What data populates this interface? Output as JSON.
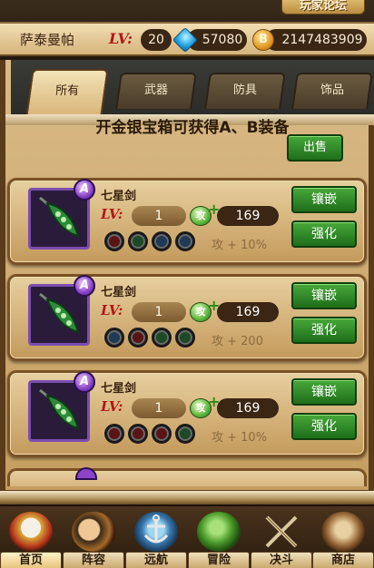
{
  "header": {
    "forum_tag": "玩家论坛",
    "player_name": "萨泰曼帕",
    "lv_label": "LV:",
    "level": "20",
    "gems": "57080",
    "coin_symbol": "B",
    "coins": "2147483909"
  },
  "tabs": [
    {
      "label": "所有",
      "active": true
    },
    {
      "label": "武器",
      "active": false
    },
    {
      "label": "防具",
      "active": false
    },
    {
      "label": "饰品",
      "active": false
    }
  ],
  "info_text": "开金银宝箱可获得A、B装备",
  "sell_label": "出售",
  "items": [
    {
      "grade": "A",
      "name": "七星剑",
      "lv_label": "LV:",
      "level": "1",
      "atk_icon_label": "攻",
      "plus": "+",
      "attack": "169",
      "bonus": "攻 + 10%",
      "sockets": [
        "red",
        "green",
        "blue",
        "blue"
      ],
      "inlay_label": "镶嵌",
      "enhance_label": "强化"
    },
    {
      "grade": "A",
      "name": "七星剑",
      "lv_label": "LV:",
      "level": "1",
      "atk_icon_label": "攻",
      "plus": "+",
      "attack": "169",
      "bonus": "攻 + 200",
      "sockets": [
        "blue",
        "red",
        "green",
        "green"
      ],
      "inlay_label": "镶嵌",
      "enhance_label": "强化"
    },
    {
      "grade": "A",
      "name": "七星剑",
      "lv_label": "LV:",
      "level": "1",
      "atk_icon_label": "攻",
      "plus": "+",
      "attack": "169",
      "bonus": "攻 + 10%",
      "sockets": [
        "red",
        "red",
        "red",
        "green"
      ],
      "inlay_label": "镶嵌",
      "enhance_label": "强化"
    }
  ],
  "nav": [
    {
      "label": "首页",
      "icon": "straw-hat-skull-icon"
    },
    {
      "label": "阵容",
      "icon": "crew-faces-icon"
    },
    {
      "label": "远航",
      "icon": "anchor-icon"
    },
    {
      "label": "冒险",
      "icon": "devil-fruit-icon"
    },
    {
      "label": "决斗",
      "icon": "crossed-swords-icon"
    },
    {
      "label": "商店",
      "icon": "shop-icon"
    }
  ],
  "colors": {
    "green_button": "#2e8a24",
    "lv_red": "#b31818",
    "grade_purple": "#8a44c8"
  }
}
